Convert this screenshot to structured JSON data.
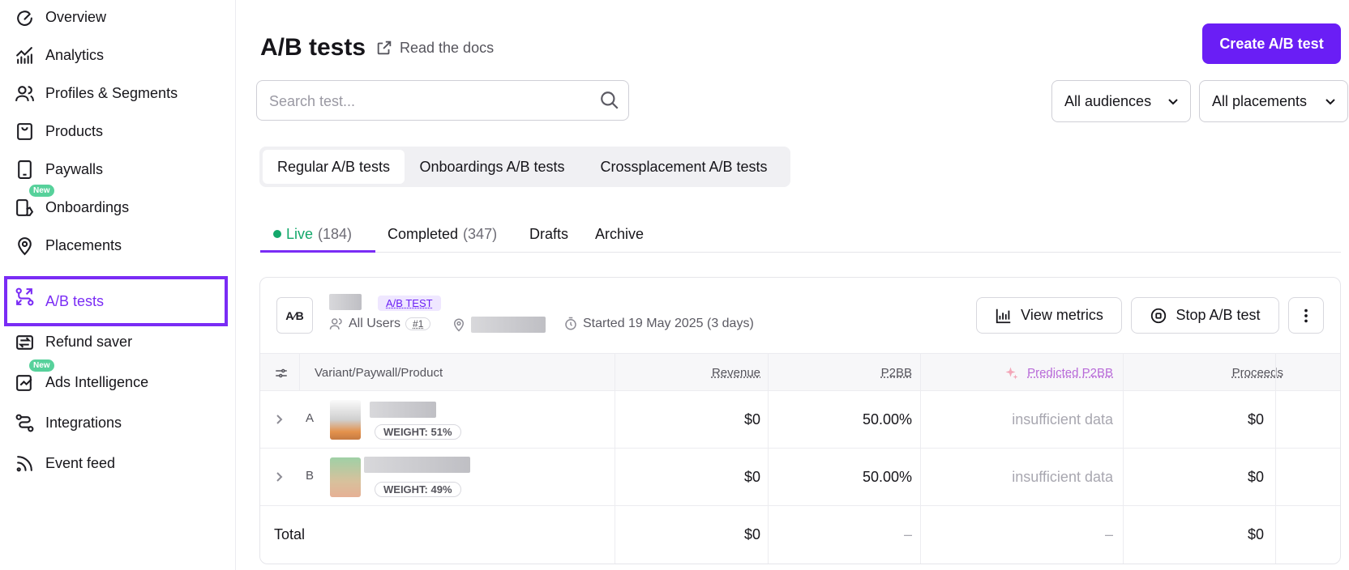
{
  "sidebar": {
    "items": [
      {
        "label": "Overview",
        "icon": "gauge-icon"
      },
      {
        "label": "Analytics",
        "icon": "chart-icon"
      },
      {
        "label": "Profiles & Segments",
        "icon": "users-icon"
      },
      {
        "label": "Products",
        "icon": "bag-icon"
      },
      {
        "label": "Paywalls",
        "icon": "phone-icon"
      },
      {
        "label": "Onboardings",
        "icon": "onboarding-icon",
        "badge": "New"
      },
      {
        "label": "Placements",
        "icon": "pin-icon"
      },
      {
        "label": "A/B tests",
        "icon": "ab-test-icon",
        "active": true
      },
      {
        "label": "Refund saver",
        "icon": "refund-icon"
      },
      {
        "label": "Ads Intelligence",
        "icon": "ads-icon",
        "badge": "New"
      },
      {
        "label": "Integrations",
        "icon": "integrations-icon"
      },
      {
        "label": "Event feed",
        "icon": "rss-icon"
      }
    ]
  },
  "header": {
    "title": "A/B tests",
    "docs_label": "Read the docs",
    "create_label": "Create A/B test"
  },
  "search": {
    "placeholder": "Search test..."
  },
  "filters": {
    "audiences": "All audiences",
    "placements": "All placements"
  },
  "test_types": [
    "Regular A/B tests",
    "Onboardings A/B tests",
    "Crossplacement A/B tests"
  ],
  "status_tabs": {
    "live": {
      "label": "Live",
      "count": "(184)"
    },
    "completed": {
      "label": "Completed",
      "count": "(347)"
    },
    "drafts": {
      "label": "Drafts"
    },
    "archive": {
      "label": "Archive"
    }
  },
  "test": {
    "icon_text": "A⁄B",
    "tag": "A/B TEST",
    "audience": "All Users",
    "audience_rank": "#1",
    "started": "Started 19 May 2025 (3 days)",
    "view_metrics": "View metrics",
    "stop": "Stop A/B test",
    "columns": {
      "variant": "Variant/Paywall/Product",
      "revenue": "Revenue",
      "p2bb": "P2BB",
      "predicted": "Predicted P2BB",
      "proceeds": "Proceeds"
    },
    "variants": [
      {
        "letter": "A",
        "weight": "WEIGHT: 51%",
        "revenue": "$0",
        "p2bb": "50.00%",
        "predicted": "insufficient data",
        "proceeds": "$0"
      },
      {
        "letter": "B",
        "weight": "WEIGHT: 49%",
        "revenue": "$0",
        "p2bb": "50.00%",
        "predicted": "insufficient data",
        "proceeds": "$0"
      }
    ],
    "total": {
      "label": "Total",
      "revenue": "$0",
      "p2bb": "–",
      "predicted": "–",
      "proceeds": "$0"
    }
  },
  "colors": {
    "accent": "#7a2cf5",
    "button": "#6a1ef5",
    "live": "#13a86b",
    "new_badge": "#57d19b"
  }
}
